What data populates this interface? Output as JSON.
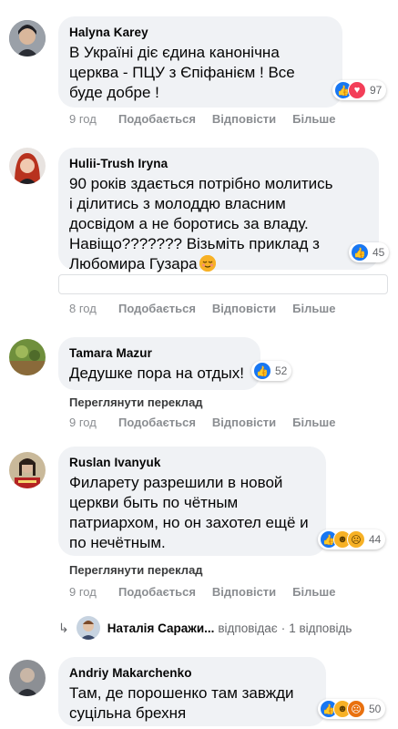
{
  "comments": [
    {
      "author": "Halyna Karey",
      "text": "В Україні діє єдина канонічна\nцерква - ПЦУ з Єпіфанієм ! Все\nбуде добре !",
      "reaction_count": "97",
      "time": "9 год",
      "like": "Подобається",
      "reply": "Відповісти",
      "more": "Більше"
    },
    {
      "author": "Hulii-Trush Iryna",
      "text": "90 років здається потрібно молитись\nі ділитись з молоддю власним\nдосвідом а не боротись за владу.\nНавіщо??????? Візьміть приклад з\nЛюбомира Гузара",
      "reaction_count": "45",
      "time": "8 год",
      "like": "Подобається",
      "reply": "Відповісти",
      "more": "Більше"
    },
    {
      "author": "Tamara Mazur",
      "text": "Дедушке пора на отдых!",
      "reaction_count": "52",
      "translate": "Переглянути переклад",
      "time": "9 год",
      "like": "Подобається",
      "reply": "Відповісти",
      "more": "Більше"
    },
    {
      "author": "Ruslan Ivanyuk",
      "text": "Филарету разрешили в новой\nцеркви быть по чётным\nпатриархом, но он захотел ещё и\nпо нечётным.",
      "reaction_count": "44",
      "translate": "Переглянути переклад",
      "time": "9 год",
      "like": "Подобається",
      "reply": "Відповісти",
      "more": "Більше"
    },
    {
      "author": "Andriy Makarchenko",
      "text": "Там, де порошенко там завжди\nсуцільна брехня",
      "reaction_count": "50"
    }
  ],
  "reply_summary": {
    "name": "Наталія Саражи...",
    "action": "відповідає",
    "separator": "·",
    "count": "1 відповідь"
  },
  "colors": {
    "bubble": "#f0f2f5",
    "meta": "#8a8d91",
    "like_blue": "#1877f2",
    "love_red": "#f33e58",
    "haha_yellow": "#f7b125"
  },
  "icons": [
    "like-icon",
    "love-icon",
    "haha-icon",
    "sad-icon",
    "angry-icon",
    "reply-arrow-icon"
  ]
}
